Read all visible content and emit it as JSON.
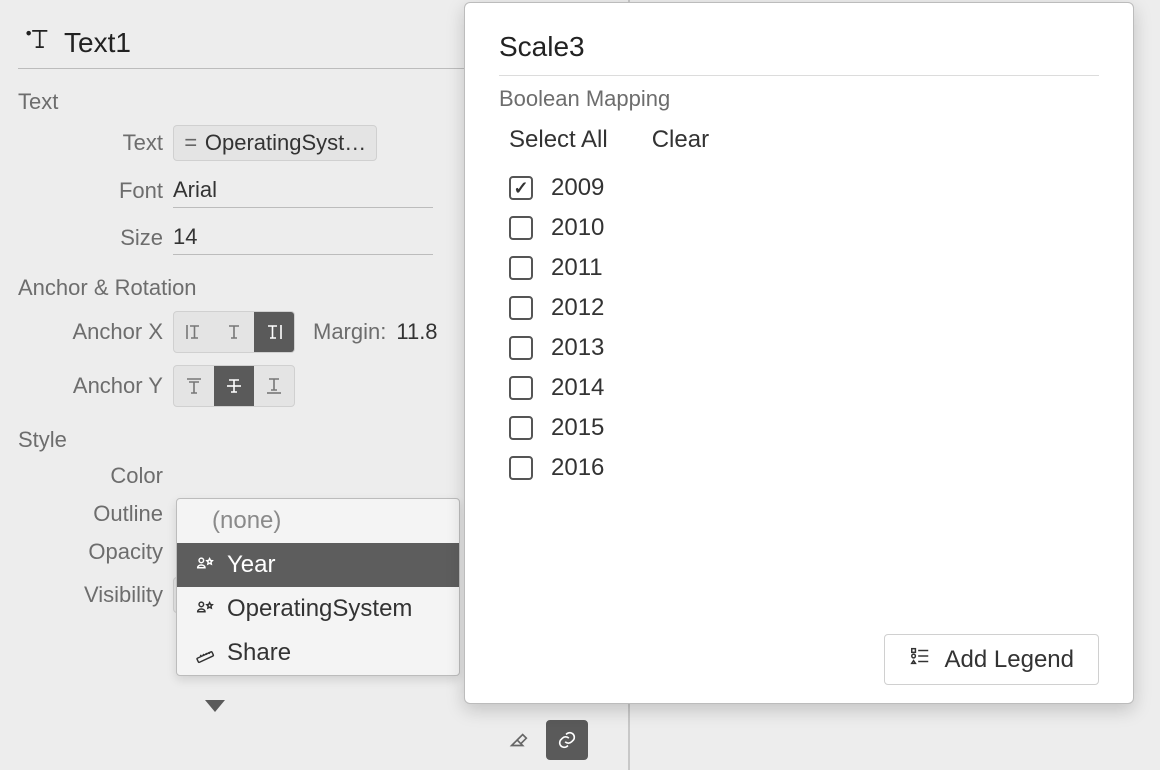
{
  "panel": {
    "title": "Text1",
    "sections": {
      "text": {
        "label": "Text",
        "text_field": {
          "label": "Text",
          "value": "OperatingSyst…"
        },
        "font_field": {
          "label": "Font",
          "value": "Arial"
        },
        "size_field": {
          "label": "Size",
          "value": "14"
        }
      },
      "anchor": {
        "label": "Anchor & Rotation",
        "anchorX": {
          "label": "Anchor X",
          "selected": 2,
          "margin_label": "Margin:",
          "margin_value": "11.8"
        },
        "anchorY": {
          "label": "Anchor Y",
          "selected": 1
        }
      },
      "style": {
        "label": "Style",
        "color": {
          "label": "Color"
        },
        "outline": {
          "label": "Outline"
        },
        "opacity": {
          "label": "Opacity"
        },
        "visibility": {
          "label": "Visibility",
          "value": "Year"
        }
      }
    }
  },
  "dropdown": {
    "none_label": "(none)",
    "items": [
      {
        "label": "Year",
        "icon": "category",
        "selected": true
      },
      {
        "label": "OperatingSystem",
        "icon": "category",
        "selected": false
      },
      {
        "label": "Share",
        "icon": "ruler",
        "selected": false
      }
    ]
  },
  "popover": {
    "title": "Scale3",
    "subtitle": "Boolean Mapping",
    "select_all": "Select All",
    "clear": "Clear",
    "options": [
      {
        "label": "2009",
        "checked": true
      },
      {
        "label": "2010",
        "checked": false
      },
      {
        "label": "2011",
        "checked": false
      },
      {
        "label": "2012",
        "checked": false
      },
      {
        "label": "2013",
        "checked": false
      },
      {
        "label": "2014",
        "checked": false
      },
      {
        "label": "2015",
        "checked": false
      },
      {
        "label": "2016",
        "checked": false
      }
    ],
    "legend_btn": "Add Legend"
  }
}
